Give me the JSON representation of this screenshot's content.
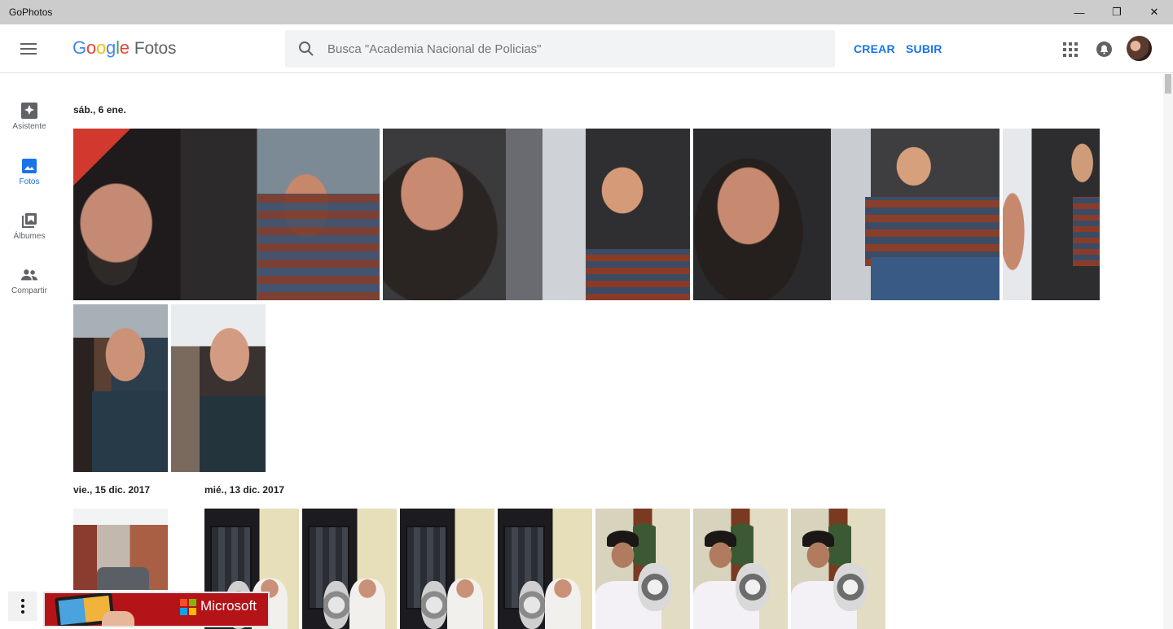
{
  "window": {
    "title": "GoPhotos",
    "controls": {
      "minimize": "—",
      "restore": "❐",
      "close": "✕"
    }
  },
  "header": {
    "logo_letters": [
      "G",
      "o",
      "o",
      "g",
      "l",
      "e"
    ],
    "logo_product": "Fotos",
    "search_placeholder": "Busca \"Academia Nacional de Policias\"",
    "crear_label": "CREAR",
    "subir_label": "SUBIR",
    "icons": [
      "menu-icon",
      "search-icon",
      "apps-grid-icon",
      "notifications-icon",
      "avatar"
    ]
  },
  "rail": {
    "items": [
      {
        "label": "Asistente",
        "icon": "assistant-icon",
        "active": false
      },
      {
        "label": "Fotos",
        "icon": "photo-icon",
        "active": true
      },
      {
        "label": "Álbumes",
        "icon": "albums-icon",
        "active": false
      },
      {
        "label": "Compartir",
        "icon": "people-icon",
        "active": false
      }
    ]
  },
  "groups": [
    {
      "date": "sáb., 6 ene.",
      "photo_count": 6
    },
    {
      "date": "vie., 15 dic. 2017",
      "photo_count": 1
    },
    {
      "date": "mié., 13 dic. 2017",
      "photo_count": 7
    }
  ],
  "ad": {
    "brand": "Microsoft",
    "colors": {
      "background": "#b41318",
      "logo_red": "#f25022",
      "logo_green": "#7fba00",
      "logo_blue": "#00a4ef",
      "logo_yellow": "#ffb900"
    }
  },
  "colors": {
    "accent": "#1a73e8",
    "titlebar": "#cccccc",
    "search_bg": "#f1f3f4"
  }
}
